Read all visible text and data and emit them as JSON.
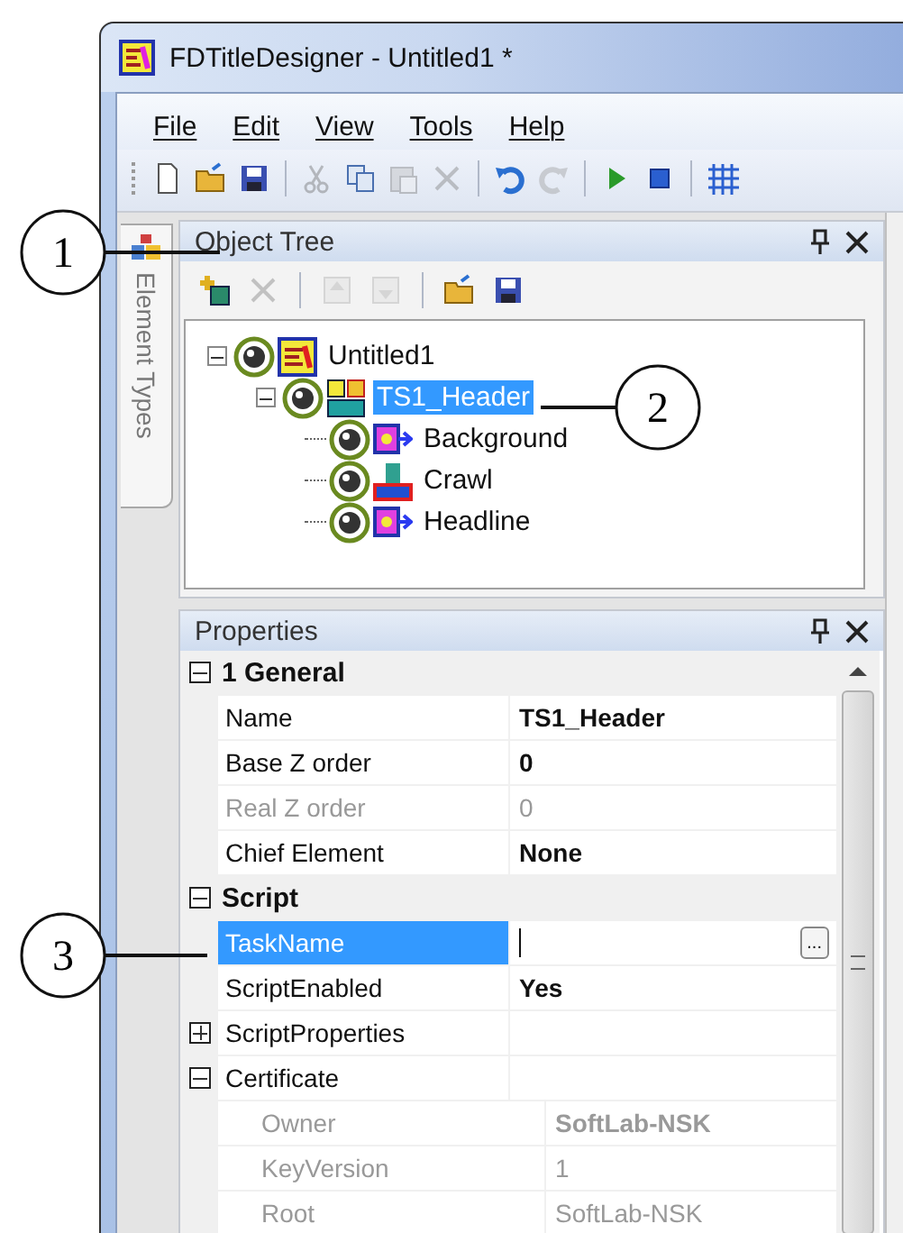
{
  "window": {
    "title": "FDTitleDesigner - Untitled1 *"
  },
  "menu": [
    {
      "label": "File"
    },
    {
      "label": "Edit"
    },
    {
      "label": "View"
    },
    {
      "label": "Tools"
    },
    {
      "label": "Help"
    }
  ],
  "toolbar": [
    {
      "kind": "new",
      "disabled": false
    },
    {
      "kind": "open",
      "disabled": false
    },
    {
      "kind": "save",
      "disabled": false
    },
    {
      "kind": "separator"
    },
    {
      "kind": "cut",
      "disabled": true
    },
    {
      "kind": "copy",
      "disabled": false
    },
    {
      "kind": "paste",
      "disabled": true
    },
    {
      "kind": "delete",
      "disabled": true
    },
    {
      "kind": "separator"
    },
    {
      "kind": "undo",
      "disabled": false
    },
    {
      "kind": "redo",
      "disabled": true
    },
    {
      "kind": "separator"
    },
    {
      "kind": "play",
      "disabled": false
    },
    {
      "kind": "stop",
      "disabled": false
    },
    {
      "kind": "separator"
    },
    {
      "kind": "grid",
      "disabled": false
    }
  ],
  "side_tab": {
    "label": "Element Types"
  },
  "object_tree": {
    "title": "Object Tree",
    "toolbar": [
      {
        "kind": "add",
        "disabled": false
      },
      {
        "kind": "delete",
        "disabled": true
      },
      {
        "kind": "separator"
      },
      {
        "kind": "up",
        "disabled": true
      },
      {
        "kind": "down",
        "disabled": true
      },
      {
        "kind": "separator"
      },
      {
        "kind": "open",
        "disabled": false
      },
      {
        "kind": "save",
        "disabled": false
      }
    ],
    "nodes": [
      {
        "label": "Untitled1",
        "kind": "project",
        "expanded": true,
        "selected": false,
        "children": [
          {
            "label": "TS1_Header",
            "kind": "group",
            "expanded": true,
            "selected": true,
            "children": [
              {
                "label": "Background",
                "kind": "image",
                "selected": false
              },
              {
                "label": "Crawl",
                "kind": "crawl",
                "selected": false
              },
              {
                "label": "Headline",
                "kind": "image",
                "selected": false
              }
            ]
          }
        ]
      }
    ]
  },
  "properties": {
    "title": "Properties",
    "sections": [
      {
        "title": "1 General",
        "expanded": true,
        "rows": [
          {
            "name": "Name",
            "value": "TS1_Header",
            "bold": true,
            "disabled": false,
            "selected": false
          },
          {
            "name": "Base Z order",
            "value": "0",
            "bold": true,
            "disabled": false,
            "selected": false
          },
          {
            "name": "Real Z order",
            "value": "0",
            "bold": false,
            "disabled": true,
            "selected": false
          },
          {
            "name": "Chief Element",
            "value": "None",
            "bold": true,
            "disabled": false,
            "selected": false
          }
        ]
      },
      {
        "title": "Script",
        "expanded": true,
        "rows": [
          {
            "name": "TaskName",
            "disabled": false,
            "selected": true,
            "button": "..."
          },
          {
            "name": "ScriptEnabled",
            "value": "Yes",
            "bold": true,
            "disabled": false,
            "selected": false
          },
          {
            "name": "ScriptProperties",
            "disabled": false,
            "selected": false,
            "expanded": false
          },
          {
            "name": "Certificate",
            "disabled": false,
            "selected": false,
            "expanded": true,
            "children": [
              {
                "name": "Owner",
                "value": "SoftLab-NSK",
                "bold": true,
                "disabled": true,
                "selected": false
              },
              {
                "name": "KeyVersion",
                "value": "1",
                "bold": false,
                "disabled": true,
                "selected": false
              },
              {
                "name": "Root",
                "value": "SoftLab-NSK",
                "bold": false,
                "disabled": true,
                "selected": false
              }
            ]
          }
        ]
      }
    ]
  },
  "callouts": [
    {
      "label": "1"
    },
    {
      "label": "2"
    },
    {
      "label": "3"
    }
  ]
}
